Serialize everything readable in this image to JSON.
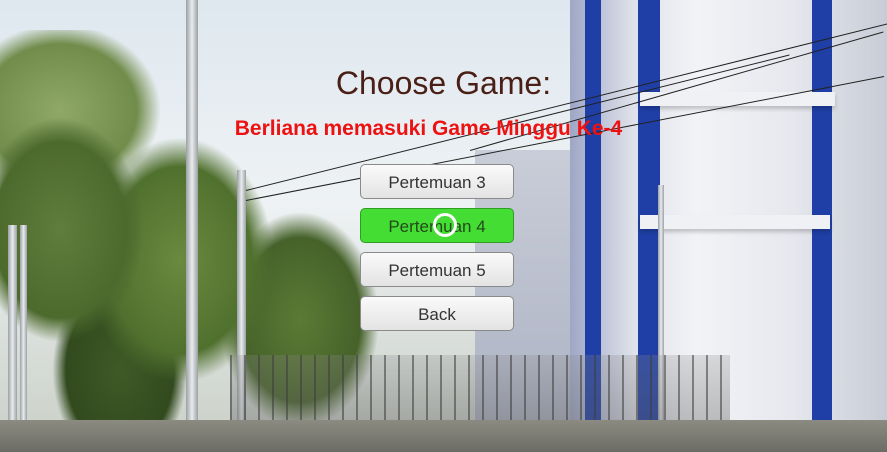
{
  "menu": {
    "title": "Choose Game:",
    "status": "Berliana memasuki Game Minggu Ke-4",
    "buttons": [
      {
        "label": "Pertemuan 3",
        "selected": false
      },
      {
        "label": "Pertemuan 4",
        "selected": true
      },
      {
        "label": "Pertemuan 5",
        "selected": false
      },
      {
        "label": "Back",
        "selected": false
      }
    ]
  },
  "colors": {
    "title": "#4a1f16",
    "status": "#ee1111",
    "selected_button": "#44dd33"
  }
}
